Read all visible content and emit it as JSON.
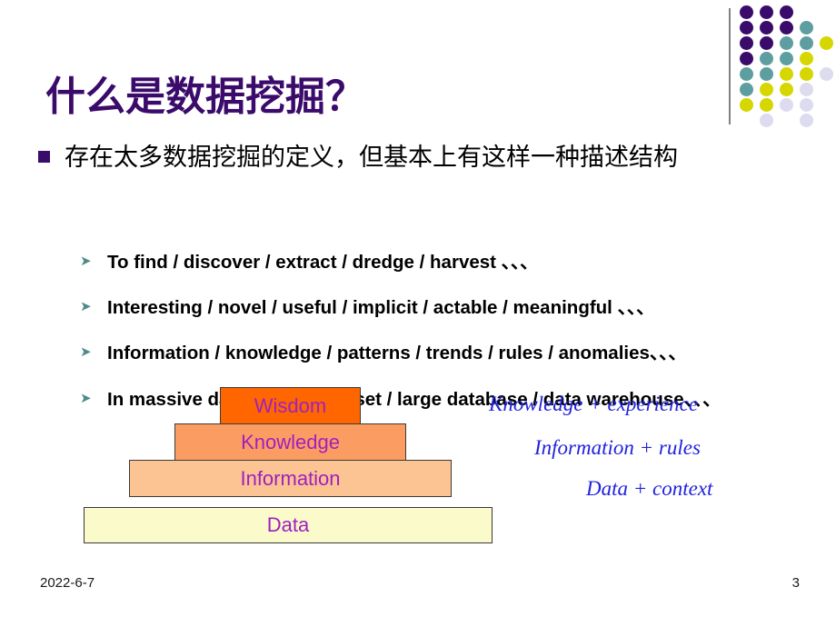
{
  "slide": {
    "title": "什么是数据挖掘？",
    "title_color": "#3B0B6B",
    "background": "#ffffff"
  },
  "bullets": {
    "level1": [
      {
        "marker": "square-bullet",
        "text": "存在太多数据挖掘的定义，但基本上有这样一种描述结构"
      }
    ],
    "level2": [
      {
        "marker": "arrow-bullet",
        "text": "To find / discover / extract  / dredge / harvest 、、、"
      },
      {
        "marker": "arrow-bullet",
        "text": "Interesting / novel / useful / implicit / actable / meaningful 、、、"
      },
      {
        "marker": "arrow-bullet",
        "text": "Information / knowledge / patterns / trends / rules / anomalies、、、"
      },
      {
        "marker": "arrow-bullet",
        "text": "In massive data / large data set / large database / data warehouse、、、"
      }
    ]
  },
  "pyramid": {
    "layers": [
      {
        "label": "Wisdom",
        "color": "#FF6600",
        "text_color": "#A020C0"
      },
      {
        "label": "Knowledge",
        "color": "#FB9D62",
        "text_color": "#A020C0"
      },
      {
        "label": "Information",
        "color": "#FBC492",
        "text_color": "#A020C0"
      },
      {
        "label": "Data",
        "color": "#FAFACA",
        "text_color": "#A020C0"
      }
    ],
    "annotations": [
      {
        "text": "Knowledge + experience",
        "color": "#2222DD"
      },
      {
        "text": "Information + rules",
        "color": "#2222DD"
      },
      {
        "text": "Data + context",
        "color": "#2222DD"
      }
    ]
  },
  "decoration": {
    "name": "dot-grid-motif",
    "colors": {
      "purple": "#3B0B6B",
      "teal": "#5F9EA0",
      "yellow": "#D6D600",
      "lavender": "#DCDCEE",
      "line": "#808080"
    },
    "grid": [
      [
        "purple",
        "purple",
        "purple",
        null,
        null
      ],
      [
        "purple",
        "purple",
        "purple",
        "teal",
        null
      ],
      [
        "purple",
        "purple",
        "teal",
        "teal",
        "yellow"
      ],
      [
        "purple",
        "teal",
        "teal",
        "yellow",
        null
      ],
      [
        "teal",
        "teal",
        "yellow",
        "yellow",
        "lavender"
      ],
      [
        "teal",
        "yellow",
        "yellow",
        "lavender",
        null
      ],
      [
        "yellow",
        "yellow",
        "lavender",
        "lavender",
        null
      ],
      [
        null,
        "lavender",
        null,
        "lavender",
        null
      ]
    ]
  },
  "footer": {
    "date": "2022-6-7",
    "page_number": "3"
  }
}
